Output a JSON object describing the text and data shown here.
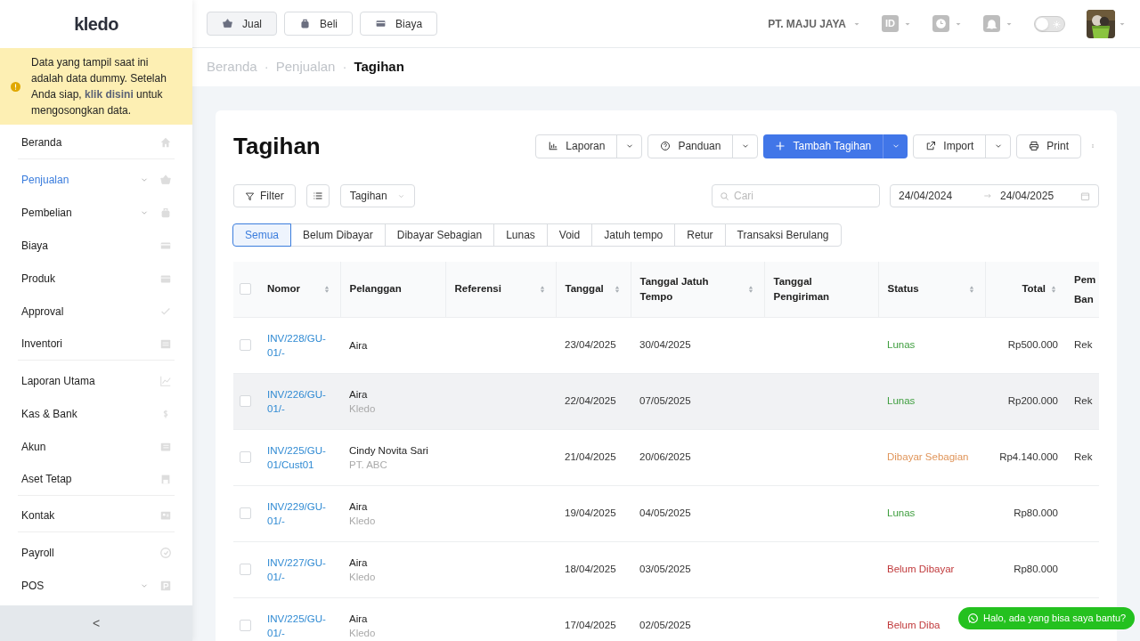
{
  "logo": "kledo",
  "notice": {
    "text": "Data yang tampil saat ini adalah data dummy. Setelah Anda siap, **klik disini** untuk mengosongkan data."
  },
  "sidebar": {
    "items": [
      {
        "label": "Beranda",
        "selected": false,
        "has_submenu": false,
        "divider_after": true
      },
      {
        "label": "Penjualan",
        "selected": true,
        "has_submenu": true,
        "divider_after": false
      },
      {
        "label": "Pembelian",
        "selected": false,
        "has_submenu": true,
        "divider_after": false
      },
      {
        "label": "Biaya",
        "selected": false,
        "has_submenu": false,
        "divider_after": false
      },
      {
        "label": "Produk",
        "selected": false,
        "has_submenu": false,
        "divider_after": false
      },
      {
        "label": "Approval",
        "selected": false,
        "has_submenu": false,
        "divider_after": false
      },
      {
        "label": "Inventori",
        "selected": false,
        "has_submenu": false,
        "divider_after": true
      },
      {
        "label": "Laporan Utama",
        "selected": false,
        "has_submenu": false,
        "divider_after": false
      },
      {
        "label": "Kas & Bank",
        "selected": false,
        "has_submenu": false,
        "divider_after": false
      },
      {
        "label": "Akun",
        "selected": false,
        "has_submenu": false,
        "divider_after": false
      },
      {
        "label": "Aset Tetap",
        "selected": false,
        "has_submenu": false,
        "divider_after": true
      },
      {
        "label": "Kontak",
        "selected": false,
        "has_submenu": false,
        "divider_after": true
      },
      {
        "label": "Payroll",
        "selected": false,
        "has_submenu": false,
        "divider_after": false
      },
      {
        "label": "POS",
        "selected": false,
        "has_submenu": true,
        "divider_after": false
      }
    ],
    "collapse": "<"
  },
  "quick_actions": [
    "Jual",
    "Beli",
    "Biaya"
  ],
  "company": "PT. MAJU JAYA",
  "language": "ID",
  "theme_toggle": {
    "on": false
  },
  "breadcrumb_separator": "·",
  "breadcrumb": [
    {
      "label": "Beranda",
      "selected": false
    },
    {
      "label": "Penjualan",
      "selected": false
    },
    {
      "label": "Tagihan",
      "selected": true
    }
  ],
  "page_title": "Tagihan",
  "toolbar": [
    {
      "label": "Laporan",
      "kind": "split"
    },
    {
      "label": "Panduan",
      "kind": "split"
    },
    {
      "label": "Tambah Tagihan",
      "kind": "primary"
    },
    {
      "label": "Import",
      "kind": "split"
    },
    {
      "label": "Print",
      "kind": "plain"
    }
  ],
  "filter_button": "Filter",
  "type_select": "Tagihan",
  "search": {
    "placeholder": "Cari"
  },
  "date_range": {
    "start": "24/04/2024",
    "end": "24/04/2025"
  },
  "status_tabs": [
    {
      "label": "Semua",
      "selected": true
    },
    {
      "label": "Belum Dibayar",
      "selected": false
    },
    {
      "label": "Dibayar Sebagian",
      "selected": false
    },
    {
      "label": "Lunas",
      "selected": false
    },
    {
      "label": "Void",
      "selected": false
    },
    {
      "label": "Jatuh tempo",
      "selected": false
    },
    {
      "label": "Retur",
      "selected": false
    },
    {
      "label": "Transaksi Berulang",
      "selected": false
    }
  ],
  "table": {
    "all_checked": false,
    "columns": [
      {
        "label": "Nomor",
        "sortable": true
      },
      {
        "label": "Pelanggan",
        "sortable": false
      },
      {
        "label": "Referensi",
        "sortable": true
      },
      {
        "label": "Tanggal",
        "sortable": true
      },
      {
        "label": "Tanggal Jatuh Tempo",
        "sortable": true
      },
      {
        "label": "Tanggal Pengiriman",
        "sortable": false
      },
      {
        "label": "Status",
        "sortable": true
      },
      {
        "label": "Total",
        "sortable": true
      },
      {
        "label": "Pem Ban",
        "sortable": false
      }
    ],
    "rows": [
      {
        "checked": false,
        "highlighted": false,
        "number": "INV/228/GU-01/-",
        "customer": "Aira",
        "date": "23/04/2025",
        "due": "30/04/2025",
        "status": "Lunas",
        "color": "#3f9e3f",
        "total": "Rp500.000",
        "payment": "Rek"
      },
      {
        "checked": false,
        "highlighted": true,
        "number": "INV/226/GU-01/-",
        "customer": "Aira",
        "company": "Kledo",
        "date": "22/04/2025",
        "due": "07/05/2025",
        "status": "Lunas",
        "color": "#3f9e3f",
        "total": "Rp200.000",
        "payment": "Rek"
      },
      {
        "checked": false,
        "highlighted": false,
        "number": "INV/225/GU-01/Cust01",
        "customer": "Cindy Novita Sari",
        "company": "PT. ABC",
        "date": "21/04/2025",
        "due": "20/06/2025",
        "status": "Dibayar Sebagian",
        "color": "#e0955a",
        "total": "Rp4.140.000",
        "payment": "Rek"
      },
      {
        "checked": false,
        "highlighted": false,
        "number": "INV/229/GU-01/-",
        "customer": "Aira",
        "company": "Kledo",
        "date": "19/04/2025",
        "due": "04/05/2025",
        "status": "Lunas",
        "color": "#3f9e3f",
        "total": "Rp80.000"
      },
      {
        "checked": false,
        "highlighted": false,
        "number": "INV/227/GU-01/-",
        "customer": "Aira",
        "company": "Kledo",
        "date": "18/04/2025",
        "due": "03/05/2025",
        "status": "Belum Dibayar",
        "color": "#c0393b",
        "total": "Rp80.000"
      },
      {
        "checked": false,
        "highlighted": false,
        "number": "INV/225/GU-01/-",
        "customer": "Aira",
        "company": "Kledo",
        "date": "17/04/2025",
        "due": "02/05/2025",
        "status": "Belum Diba",
        "color": "#c0393b"
      }
    ]
  },
  "chat_button": "Halo, ada yang bisa saya bantu?"
}
